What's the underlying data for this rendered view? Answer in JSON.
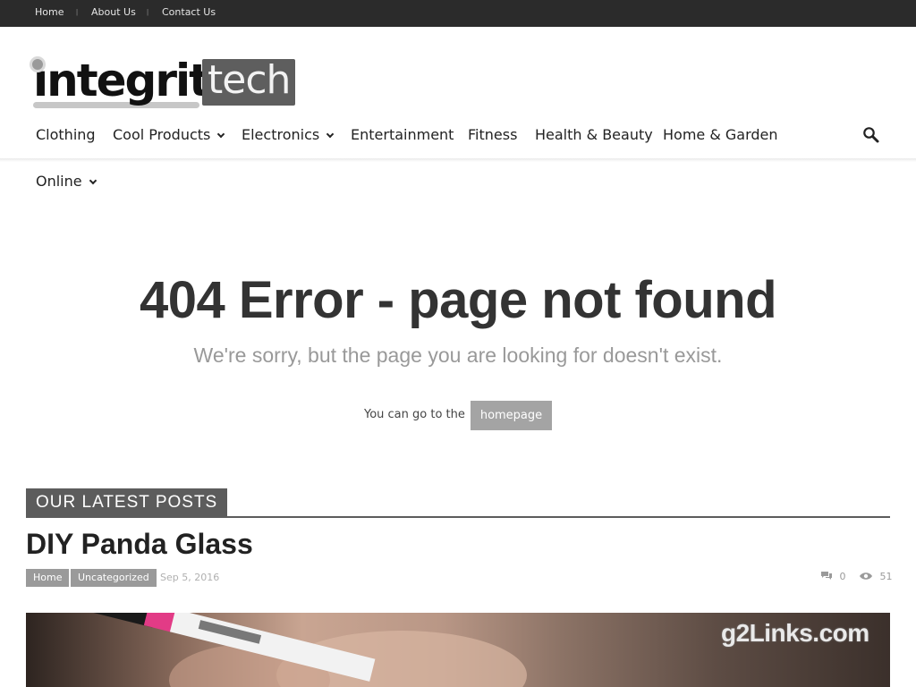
{
  "topbar": {
    "links": [
      "Home",
      "About Us",
      "Contact Us"
    ],
    "separator": "|"
  },
  "logo": {
    "word1": "integrity",
    "word2": "tech"
  },
  "menu": {
    "items": [
      {
        "label": "Clothing",
        "has_dropdown": false
      },
      {
        "label": "Cool Products",
        "has_dropdown": true
      },
      {
        "label": "Electronics",
        "has_dropdown": true
      },
      {
        "label": "Entertainment",
        "has_dropdown": false
      },
      {
        "label": "Fitness",
        "has_dropdown": false
      },
      {
        "label": "Health & Beauty",
        "has_dropdown": false
      },
      {
        "label": "Home & Garden",
        "has_dropdown": false
      },
      {
        "label": "Online",
        "has_dropdown": true
      }
    ],
    "search_icon": "search-icon"
  },
  "error": {
    "title": "404 Error - page not found",
    "subtitle": "We're sorry, but the page you are looking for doesn't exist.",
    "goto_text": "You can go to the",
    "homepage_button": "homepage"
  },
  "latest_posts": {
    "section_title": "OUR LATEST POSTS",
    "post": {
      "title": "DIY Panda Glass",
      "tags": [
        "Home",
        "Uncategorized"
      ],
      "date": "Sep 5, 2016",
      "comments": "0",
      "views": "51"
    }
  },
  "watermark": "g2Links.com",
  "colors": {
    "topbar_bg": "#2b2b2b",
    "accent_gray": "#5c5c5c",
    "button_gray": "#a4a4a4"
  }
}
